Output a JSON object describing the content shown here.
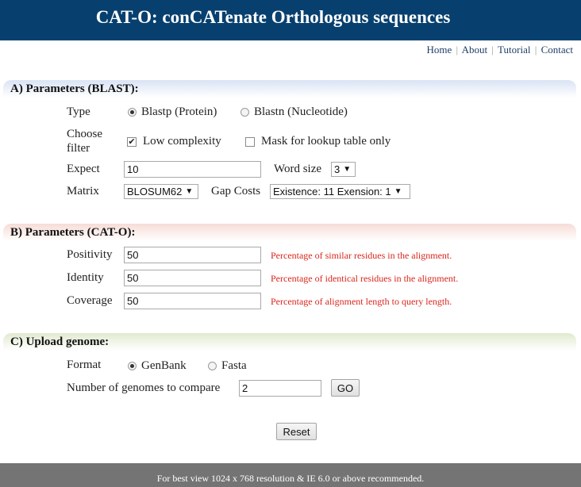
{
  "header": {
    "title": "CAT-O: conCATenate Orthologous sequences"
  },
  "nav": {
    "items": [
      "Home",
      "About",
      "Tutorial",
      "Contact"
    ],
    "separator": "|"
  },
  "section_a": {
    "title": "A) Parameters (BLAST):",
    "type_label": "Type",
    "type_options": [
      {
        "label": "Blastp (Protein)",
        "selected": true
      },
      {
        "label": "Blastn (Nucleotide)",
        "selected": false
      }
    ],
    "filter_label_line1": "Choose",
    "filter_label_line2": "filter",
    "filter_options": [
      {
        "label": "Low complexity",
        "checked": true
      },
      {
        "label": "Mask for lookup table only",
        "checked": false
      }
    ],
    "expect_label": "Expect",
    "expect_value": "10",
    "word_size_label": "Word size",
    "word_size_value": "3",
    "matrix_label": "Matrix",
    "matrix_value": "BLOSUM62",
    "gap_costs_label": "Gap Costs",
    "gap_costs_value": "Existence: 11 Exension: 1"
  },
  "section_b": {
    "title": "B) Parameters (CAT-O):",
    "rows": [
      {
        "label": "Positivity",
        "value": "50",
        "hint": "Percentage of similar residues in the alignment."
      },
      {
        "label": "Identity",
        "value": "50",
        "hint": "Percentage of identical residues in the alignment."
      },
      {
        "label": "Coverage",
        "value": "50",
        "hint": "Percentage of alignment length to query length."
      }
    ]
  },
  "section_c": {
    "title": "C) Upload genome:",
    "format_label": "Format",
    "format_options": [
      {
        "label": "GenBank",
        "selected": true
      },
      {
        "label": "Fasta",
        "selected": false
      }
    ],
    "genomes_label": "Number of genomes to compare",
    "genomes_value": "2",
    "go_label": "GO"
  },
  "reset_label": "Reset",
  "footer": {
    "note": "For best view 1024 x 768 resolution & IE 6.0 or above recommended."
  },
  "colors": {
    "header_bg": "#07406f",
    "footer_bg": "#747474",
    "hint_text": "#d9261c"
  }
}
